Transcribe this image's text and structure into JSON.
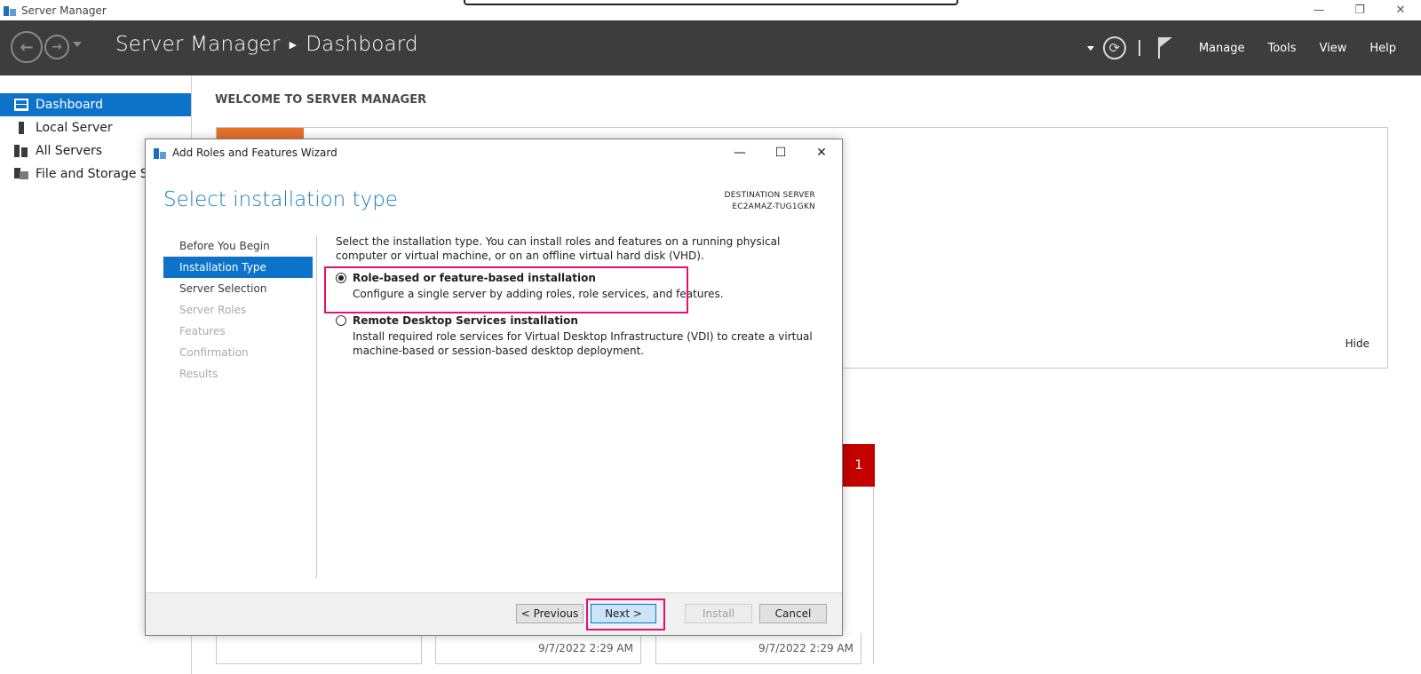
{
  "window": {
    "title": "Server Manager",
    "controls": {
      "minimize": "—",
      "restore": "❐",
      "close": "✕"
    }
  },
  "header": {
    "breadcrumb_app": "Server Manager",
    "breadcrumb_sep": "▶",
    "breadcrumb_page": "Dashboard",
    "menus": [
      "Manage",
      "Tools",
      "View",
      "Help"
    ]
  },
  "sidebar": {
    "items": [
      {
        "label": "Dashboard",
        "icon": "dashboard-icon"
      },
      {
        "label": "Local Server",
        "icon": "local-server-icon"
      },
      {
        "label": "All Servers",
        "icon": "all-servers-icon"
      },
      {
        "label": "File and Storage Ser",
        "icon": "file-storage-icon"
      }
    ]
  },
  "main": {
    "welcome": "WELCOME TO SERVER MANAGER",
    "hide": "Hide",
    "badge_count": "1",
    "tile_timestamps": [
      "9/7/2022 2:29 AM",
      "9/7/2022 2:29 AM"
    ]
  },
  "wizard": {
    "title": "Add Roles and Features Wizard",
    "page_title": "Select installation type",
    "destination_label": "DESTINATION SERVER",
    "destination_server": "EC2AMAZ-TUG1GKN",
    "steps": [
      {
        "label": "Before You Begin",
        "state": "done"
      },
      {
        "label": "Installation Type",
        "state": "active"
      },
      {
        "label": "Server Selection",
        "state": "done"
      },
      {
        "label": "Server Roles",
        "state": "disabled"
      },
      {
        "label": "Features",
        "state": "disabled"
      },
      {
        "label": "Confirmation",
        "state": "disabled"
      },
      {
        "label": "Results",
        "state": "disabled"
      }
    ],
    "intro": "Select the installation type. You can install roles and features on a running physical computer or virtual machine, or on an offline virtual hard disk (VHD).",
    "options": [
      {
        "label": "Role-based or feature-based installation",
        "desc": "Configure a single server by adding roles, role services, and features.",
        "checked": true
      },
      {
        "label": "Remote Desktop Services installation",
        "desc": "Install required role services for Virtual Desktop Infrastructure (VDI) to create a virtual machine-based or session-based desktop deployment.",
        "checked": false
      }
    ],
    "buttons": {
      "previous": "< Previous",
      "next": "Next >",
      "install": "Install",
      "cancel": "Cancel"
    }
  },
  "colors": {
    "accent": "#0d73c9",
    "highlight": "#e0116f",
    "title_blue": "#1a7eb5",
    "badge_red": "#c40000",
    "header_dark": "#3d3d3d"
  }
}
